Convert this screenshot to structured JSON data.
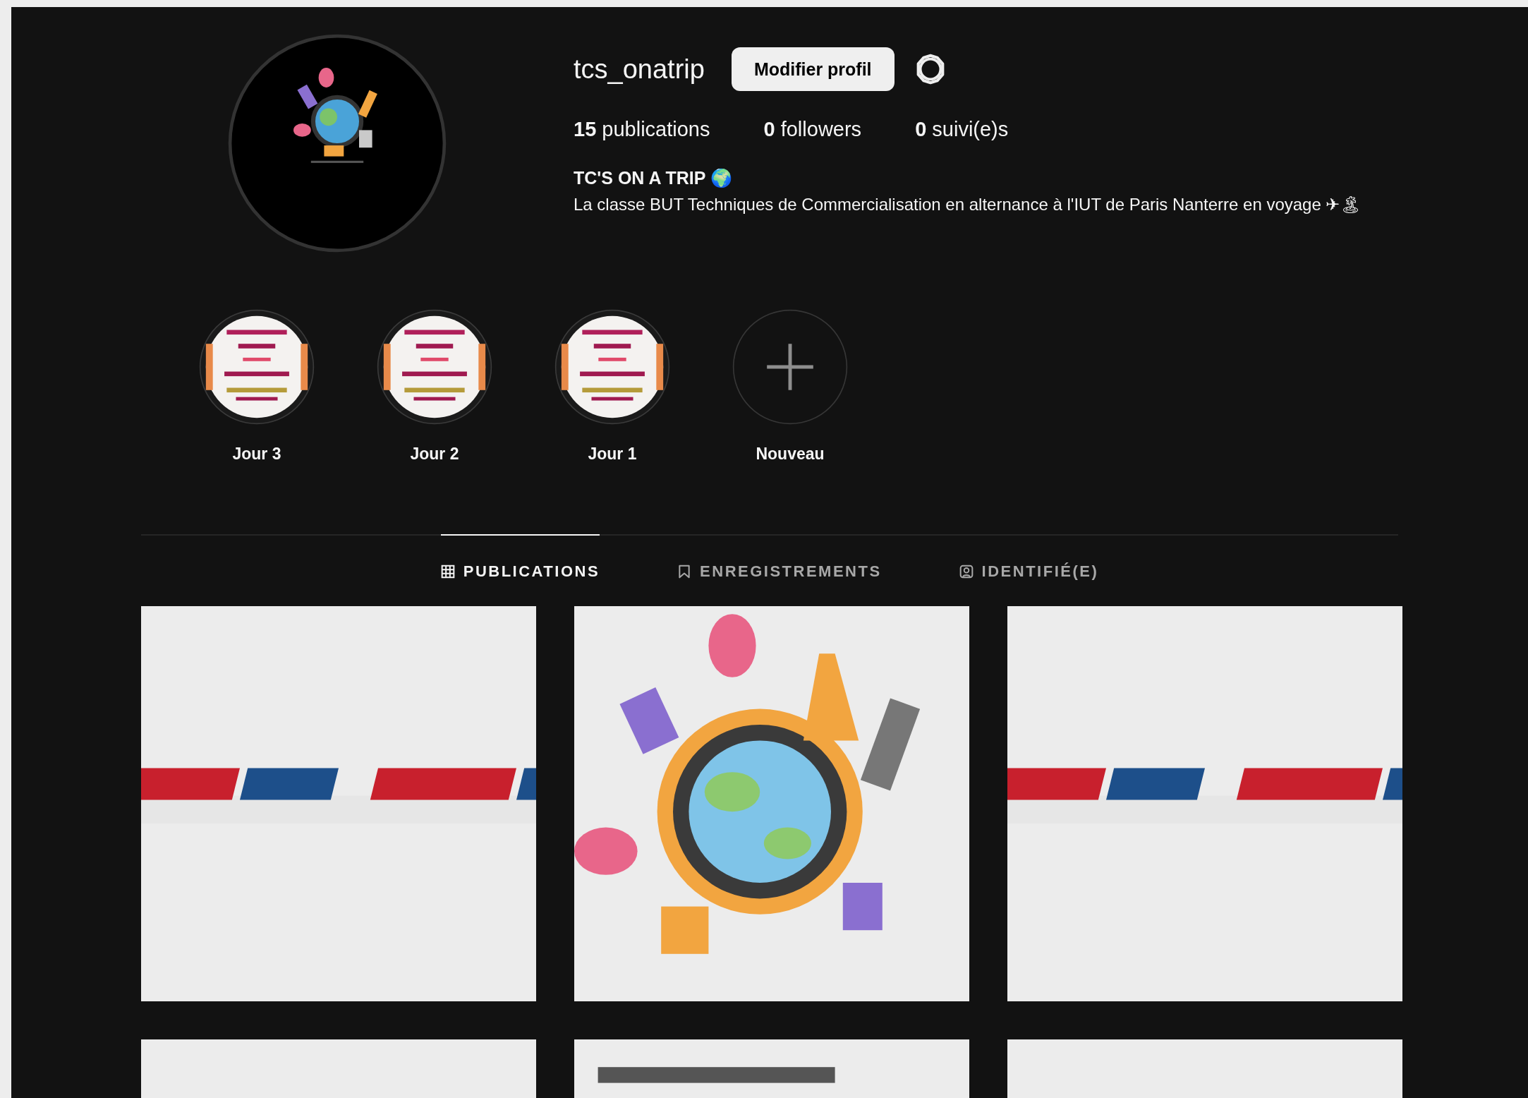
{
  "profile": {
    "avatar": {
      "kind": "picture"
    },
    "username": "tcs_onatrip",
    "edit_button": "Modifier profil",
    "stats": [
      "**15** publications",
      "**0** followers",
      "**0** suivi(e)s"
    ],
    "bio_title": "TC'S ON A TRIP 🌍",
    "bio": "La classe BUT Techniques de Commercialisation en alternance à l'IUT de Paris Nanterre en voyage ✈🏝"
  },
  "highlights": [
    {
      "label": "Jour 3",
      "kind": "picture"
    },
    {
      "label": "Jour 2",
      "kind": "picture"
    },
    {
      "label": "Jour 1",
      "kind": "picture"
    },
    {
      "label": "Nouveau",
      "kind": "new"
    }
  ],
  "tabs": [
    {
      "label": "PUBLICATIONS",
      "kind": "grid",
      "selected": true
    },
    {
      "label": "ENREGISTREMENTS",
      "kind": "bookmark",
      "selected": false
    },
    {
      "label": "IDENTIFIÉ(E)",
      "kind": "tag",
      "selected": false
    }
  ],
  "posts": [
    {
      "kind": "picture"
    },
    {
      "kind": "picture"
    },
    {
      "kind": "picture"
    },
    {
      "kind": "picture"
    },
    {
      "kind": "picture"
    },
    {
      "kind": "picture"
    }
  ]
}
